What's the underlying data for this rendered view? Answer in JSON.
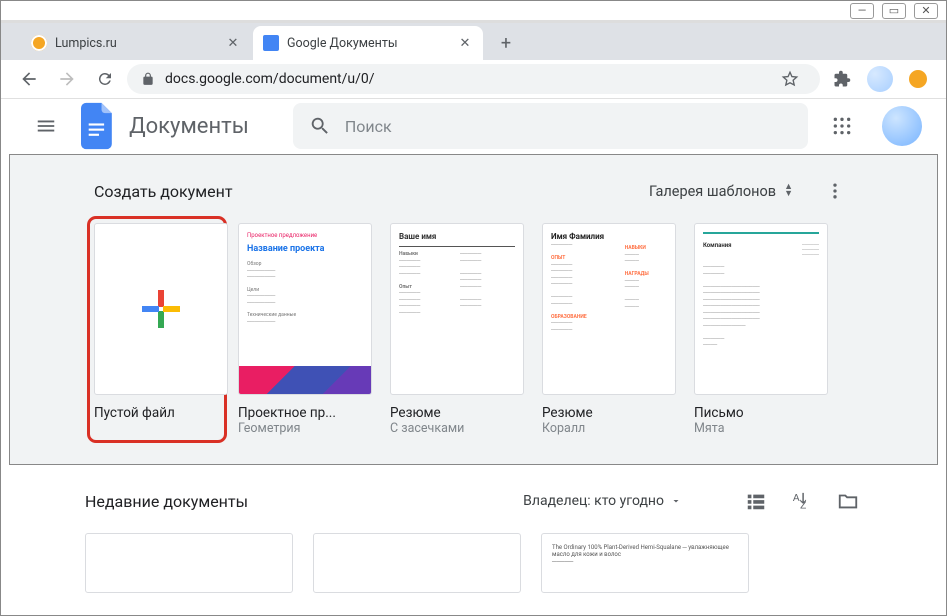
{
  "tabs": [
    {
      "title": "Lumpics.ru",
      "favicon": "#f5a623",
      "active": false
    },
    {
      "title": "Google Документы",
      "favicon": "#4285f4",
      "active": true
    }
  ],
  "url": "docs.google.com/document/u/0/",
  "app": {
    "title": "Документы"
  },
  "search": {
    "placeholder": "Поиск"
  },
  "templates": {
    "heading": "Создать документ",
    "gallery_label": "Галерея шаблонов",
    "items": [
      {
        "title": "Пустой файл",
        "subtitle": ""
      },
      {
        "title": "Проектное пр...",
        "subtitle": "Геометрия"
      },
      {
        "title": "Резюме",
        "subtitle": "С засечками"
      },
      {
        "title": "Резюме",
        "subtitle": "Коралл"
      },
      {
        "title": "Письмо",
        "subtitle": "Мята"
      }
    ]
  },
  "recent": {
    "heading": "Недавние документы",
    "owner_filter": "Владелец: кто угодно"
  }
}
